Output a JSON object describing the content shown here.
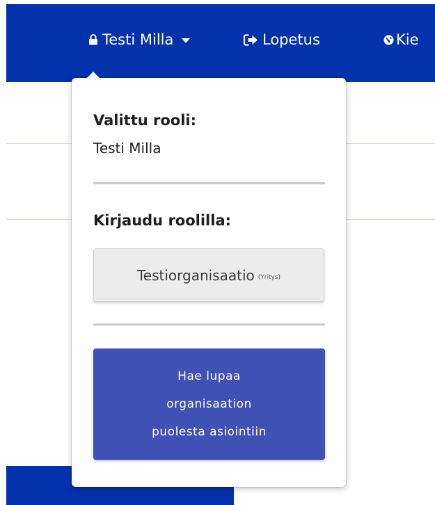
{
  "nav": {
    "user_label": "Testi Milla",
    "logout_label": "Lopetus",
    "language_label": "Kie"
  },
  "popover": {
    "selected_role_heading": "Valittu rooli:",
    "selected_role_value": "Testi Milla",
    "login_with_role_heading": "Kirjaudu roolilla:",
    "organization": {
      "name": "Testiorganisaatio",
      "type": "(Yritys)"
    },
    "request_permission_lines": [
      "Hae lupaa",
      "organisaation",
      "puolesta asiointiin"
    ]
  },
  "icons": {
    "user_menu": "lock-icon",
    "user_menu_toggle": "caret-down-icon",
    "logout": "sign-out-icon",
    "language": "globe-icon"
  },
  "colors": {
    "nav_background": "#0432ac",
    "primary_button": "#3f51b5",
    "secondary_button": "#ececec"
  }
}
